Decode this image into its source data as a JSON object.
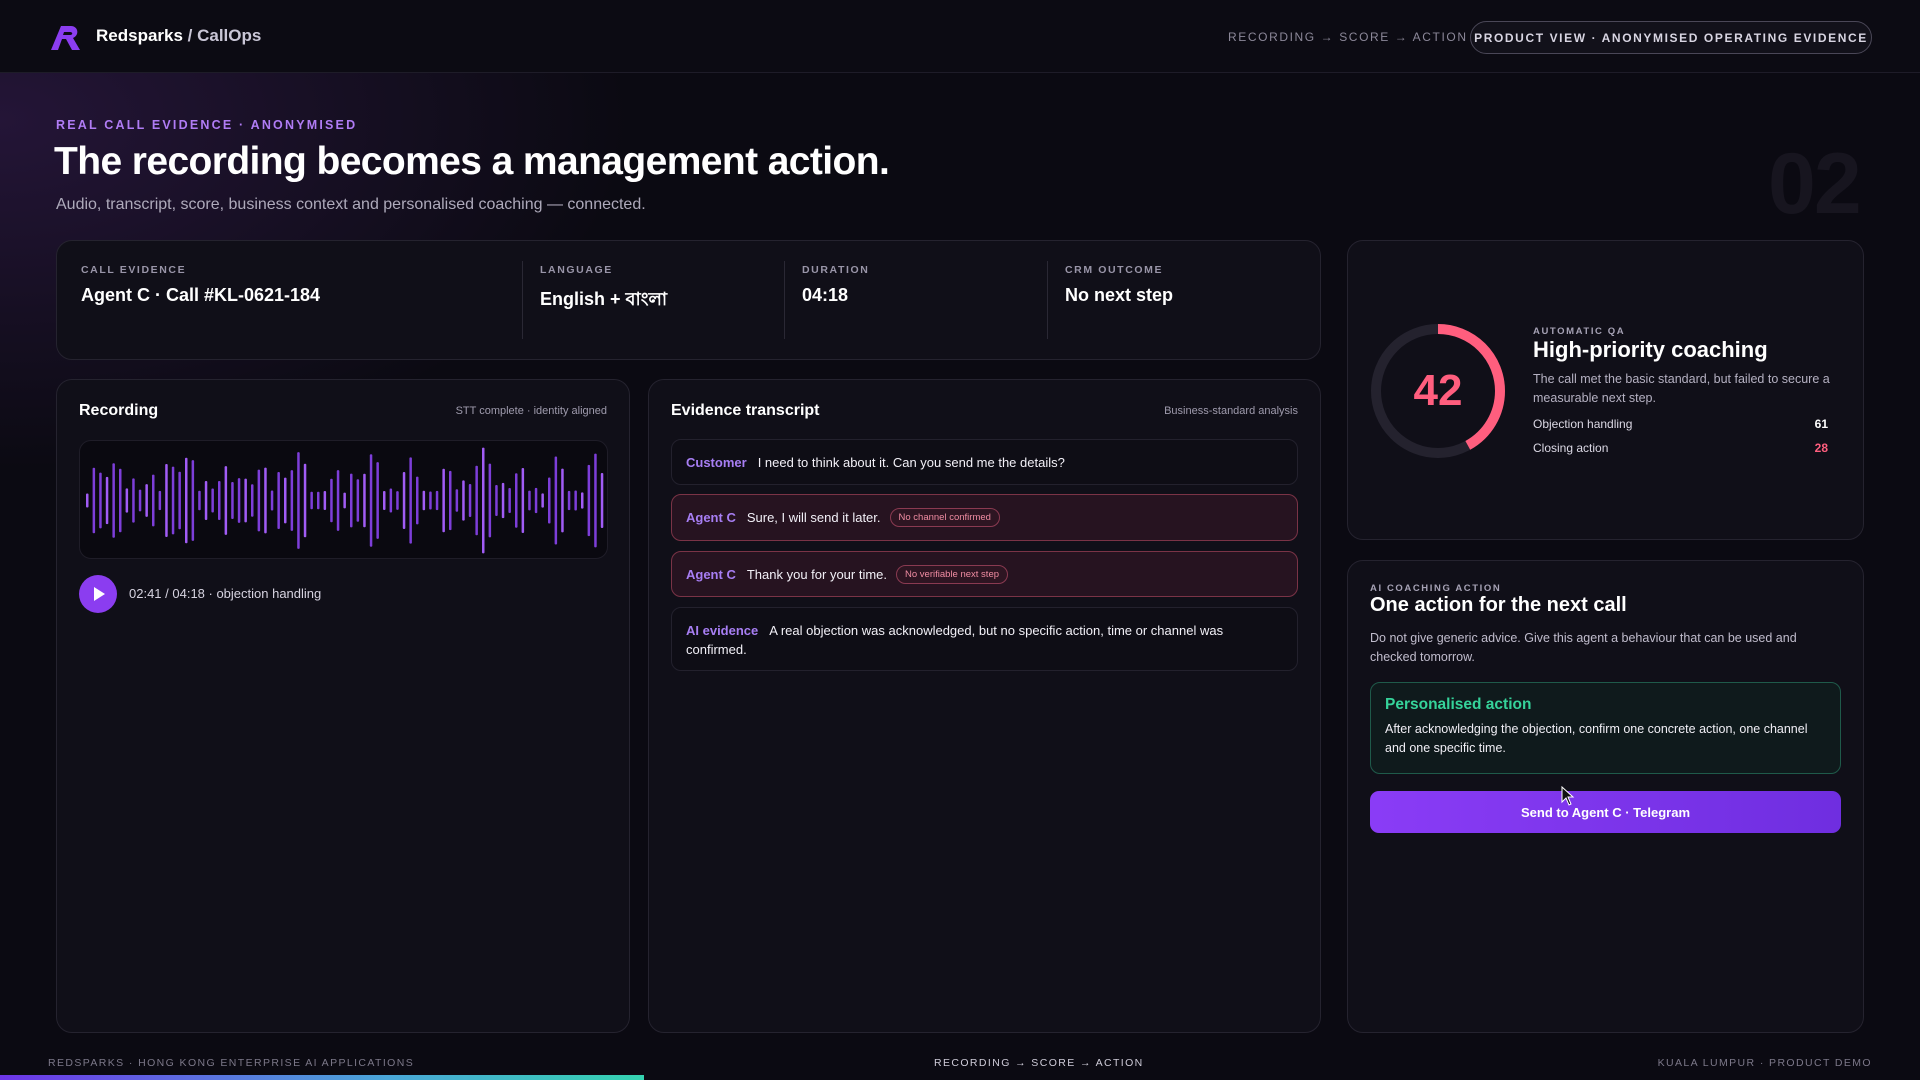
{
  "topbar": {
    "brand": "Redsparks",
    "brand_sub": " / CallOps",
    "flow": "RECORDING → SCORE → ACTION",
    "pill": "PRODUCT VIEW · ANONYMISED OPERATING EVIDENCE"
  },
  "hero": {
    "eyebrow": "REAL CALL EVIDENCE · ANONYMISED",
    "title": "The recording becomes a management action.",
    "lede": "Audio, transcript, score, business context and personalised coaching — connected.",
    "page_number": "02"
  },
  "meta": [
    {
      "label": "CALL EVIDENCE",
      "value": "Agent C · Call #KL-0621-184"
    },
    {
      "label": "LANGUAGE",
      "value": "English + বাংলা"
    },
    {
      "label": "DURATION",
      "value": "04:18"
    },
    {
      "label": "CRM OUTCOME",
      "value": "No next step"
    }
  ],
  "recording": {
    "title": "Recording",
    "note": "STT complete · identity aligned",
    "time": "02:41 / 04:18 · objection handling",
    "play_icon": "play-icon"
  },
  "transcript": {
    "title": "Evidence transcript",
    "note": "Business-standard analysis",
    "rows": [
      {
        "speaker": "Customer",
        "text": "I need to think about it. Can you send me the details?",
        "tag": ""
      },
      {
        "speaker": "Agent C",
        "text": "Sure, I will send it later.",
        "tag": "No channel confirmed"
      },
      {
        "speaker": "Agent C",
        "text": "Thank you for your time.",
        "tag": "No verifiable next step"
      },
      {
        "speaker": "AI evidence",
        "text": "A real objection was acknowledged, but no specific action, time or channel was confirmed.",
        "tag": ""
      }
    ]
  },
  "qa": {
    "score": "42",
    "score_fraction": 0.42,
    "eyebrow": "AUTOMATIC QA",
    "title": "High-priority coaching",
    "desc": "The call met the basic standard, but failed to secure a measurable next step.",
    "metrics": [
      {
        "label": "Objection handling",
        "value": "61"
      },
      {
        "label": "Closing action",
        "value": "28"
      }
    ],
    "accent": "#ff5e7e"
  },
  "coaching": {
    "eyebrow": "AI COACHING ACTION",
    "title": "One action for the next call",
    "desc": "Do not give generic advice. Give this agent a behaviour that can be used and checked tomorrow.",
    "action_title": "Personalised action",
    "action_text": "After acknowledging the objection, confirm one concrete action, one channel and one specific time.",
    "button": "Send to Agent C · Telegram"
  },
  "footer": {
    "left": "REDSPARKS · HONG KONG ENTERPRISE AI APPLICATIONS",
    "center": "RECORDING → SCORE → ACTION",
    "right": "KUALA LUMPUR · PRODUCT DEMO"
  },
  "colors": {
    "accent_purple": "#8b3df0",
    "warn_pink": "#f08ca2",
    "success_green": "#35d39a"
  }
}
